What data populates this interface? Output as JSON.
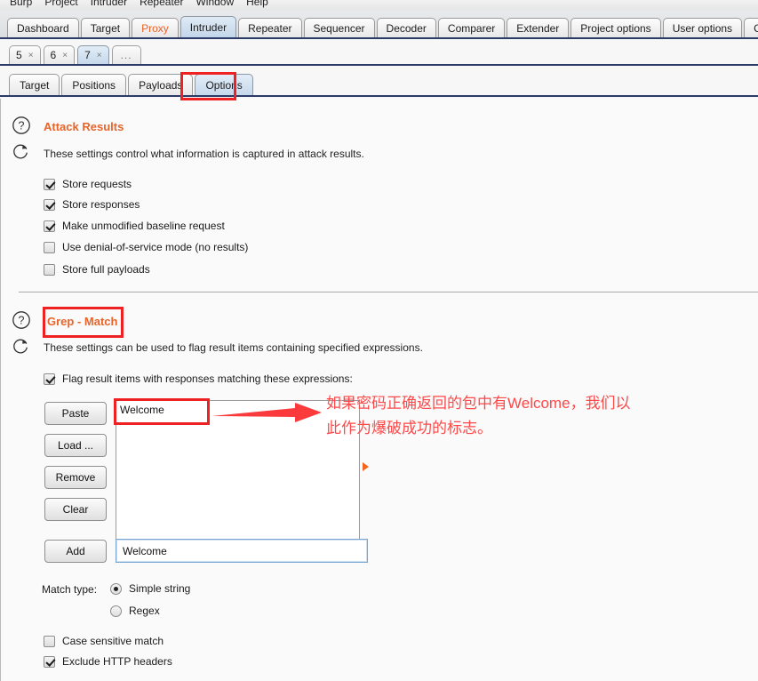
{
  "menu": {
    "items": [
      "Burp",
      "Project",
      "Intruder",
      "Repeater",
      "Window",
      "Help"
    ]
  },
  "top_tabs": [
    {
      "label": "Dashboard",
      "state": "normal"
    },
    {
      "label": "Target",
      "state": "normal"
    },
    {
      "label": "Proxy",
      "state": "alert"
    },
    {
      "label": "Intruder",
      "state": "active"
    },
    {
      "label": "Repeater",
      "state": "normal"
    },
    {
      "label": "Sequencer",
      "state": "normal"
    },
    {
      "label": "Decoder",
      "state": "normal"
    },
    {
      "label": "Comparer",
      "state": "normal"
    },
    {
      "label": "Extender",
      "state": "normal"
    },
    {
      "label": "Project options",
      "state": "normal"
    },
    {
      "label": "User options",
      "state": "normal"
    },
    {
      "label": "CSRF T",
      "state": "normal"
    }
  ],
  "attack_tabs": [
    {
      "label": "5",
      "close": "×",
      "state": "normal"
    },
    {
      "label": "6",
      "close": "×",
      "state": "normal"
    },
    {
      "label": "7",
      "close": "×",
      "state": "active"
    },
    {
      "label": "...",
      "close": "",
      "state": "dots"
    }
  ],
  "sub_tabs": [
    {
      "label": "Target",
      "state": "normal"
    },
    {
      "label": "Positions",
      "state": "normal"
    },
    {
      "label": "Payloads",
      "state": "normal"
    },
    {
      "label": "Options",
      "state": "active"
    }
  ],
  "attack_results": {
    "title": "Attack Results",
    "description": "These settings control what information is captured in attack results.",
    "help_icon": "question-mark-icon",
    "reset_icon": "refresh-icon",
    "checkboxes": [
      {
        "label": "Store requests",
        "checked": true
      },
      {
        "label": "Store responses",
        "checked": true
      },
      {
        "label": "Make unmodified baseline request",
        "checked": true
      },
      {
        "label": "Use denial-of-service mode (no results)",
        "checked": false
      },
      {
        "label": "Store full payloads",
        "checked": false
      }
    ]
  },
  "grep_match": {
    "title": "Grep - Match",
    "description": "These settings can be used to flag result items containing specified expressions.",
    "help_icon": "question-mark-icon",
    "reset_icon": "refresh-icon",
    "flag_checkbox": {
      "label": "Flag result items with responses matching these expressions:",
      "checked": true
    },
    "buttons": [
      "Paste",
      "Load ...",
      "Remove",
      "Clear"
    ],
    "list_items": [
      "Welcome"
    ],
    "add_button": "Add",
    "add_field_value": "Welcome",
    "add_field_placeholder": "",
    "match_type_label": "Match type:",
    "match_type_options": [
      {
        "label": "Simple string",
        "selected": true
      },
      {
        "label": "Regex",
        "selected": false
      }
    ],
    "bottom_checkboxes": [
      {
        "label": "Case sensitive match",
        "checked": false
      },
      {
        "label": "Exclude HTTP headers",
        "checked": true
      }
    ]
  },
  "annotations": {
    "note_line1": "如果密码正确返回的包中有Welcome，我们以",
    "note_line2": "此作为爆破成功的标志。",
    "color": "#fc4a4a",
    "box_color": "#ee2222"
  }
}
